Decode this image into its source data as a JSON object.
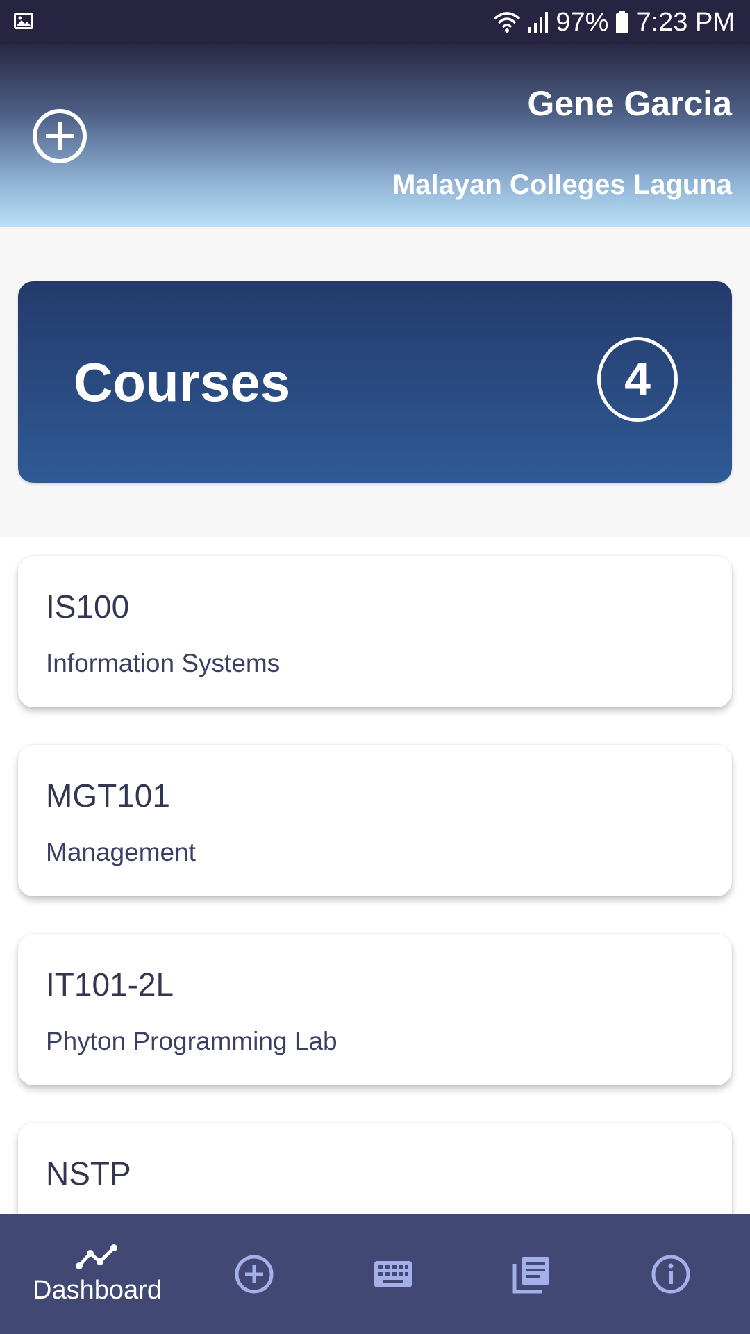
{
  "status_bar": {
    "battery": "97%",
    "time": "7:23 PM",
    "left_icon": "image-icon",
    "icons": [
      "wifi-icon",
      "signal-icon",
      "battery-icon"
    ]
  },
  "header": {
    "user_name": "Gene Garcia",
    "school": "Malayan Colleges Laguna",
    "add_icon": "plus-circle-icon"
  },
  "courses_summary": {
    "title": "Courses",
    "count": "4"
  },
  "courses": [
    {
      "code": "IS100",
      "name": "Information Systems"
    },
    {
      "code": "MGT101",
      "name": "Management"
    },
    {
      "code": "IT101-2L",
      "name": "Phyton Programming Lab"
    },
    {
      "code": "NSTP",
      "name": ""
    }
  ],
  "bottom_nav": {
    "items": [
      {
        "label": "Dashboard",
        "icon": "trend-line-icon",
        "active": true
      },
      {
        "label": "",
        "icon": "plus-circle-icon"
      },
      {
        "label": "",
        "icon": "keyboard-icon"
      },
      {
        "label": "",
        "icon": "library-books-icon"
      },
      {
        "label": "",
        "icon": "info-icon"
      }
    ]
  },
  "colors": {
    "status_bar": "#272441",
    "courses_card_top": "#243a6b",
    "courses_card_bottom": "#2f5a95",
    "nav_bg": "#414874",
    "nav_icon": "#a5b0ea",
    "text_dark": "#333652"
  }
}
